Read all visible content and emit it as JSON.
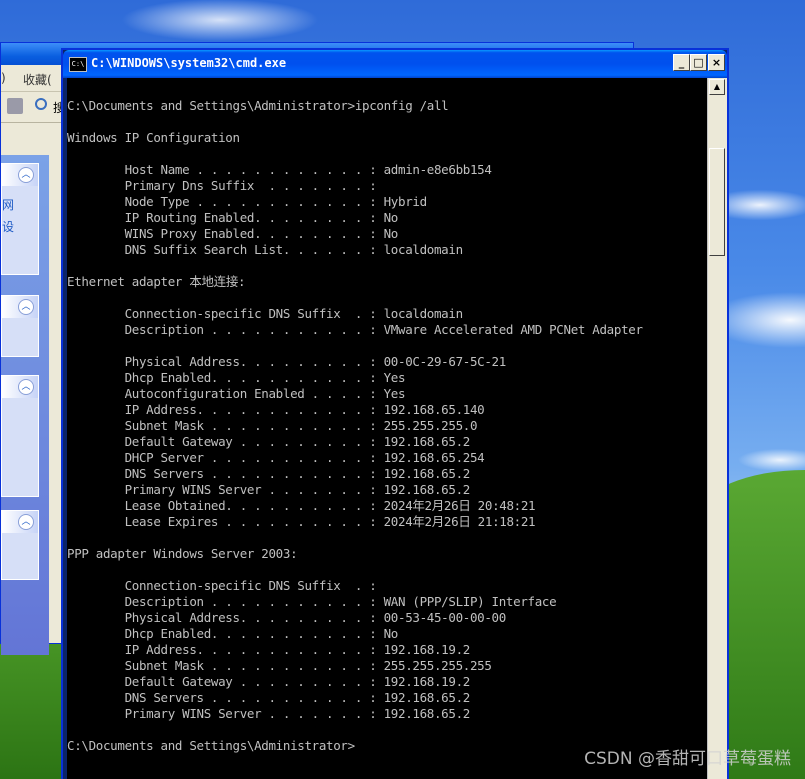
{
  "background_window": {
    "toolbar_left": ")",
    "toolbar_favorites": "收藏(",
    "toolbar_search_fragment": "搜",
    "task_fragments": [
      "网",
      "设"
    ]
  },
  "cmd": {
    "title": "C:\\WINDOWS\\system32\\cmd.exe",
    "minimize": "_",
    "maximize": "□",
    "close": "×",
    "lines": [
      "C:\\Documents and Settings\\Administrator>ipconfig /all",
      "",
      "Windows IP Configuration",
      "",
      "        Host Name . . . . . . . . . . . . : admin-e8e6bb154",
      "        Primary Dns Suffix  . . . . . . . :",
      "        Node Type . . . . . . . . . . . . : Hybrid",
      "        IP Routing Enabled. . . . . . . . : No",
      "        WINS Proxy Enabled. . . . . . . . : No",
      "        DNS Suffix Search List. . . . . . : localdomain",
      "",
      "Ethernet adapter 本地连接:",
      "",
      "        Connection-specific DNS Suffix  . : localdomain",
      "        Description . . . . . . . . . . . : VMware Accelerated AMD PCNet Adapter",
      "",
      "        Physical Address. . . . . . . . . : 00-0C-29-67-5C-21",
      "        Dhcp Enabled. . . . . . . . . . . : Yes",
      "        Autoconfiguration Enabled . . . . : Yes",
      "        IP Address. . . . . . . . . . . . : 192.168.65.140",
      "        Subnet Mask . . . . . . . . . . . : 255.255.255.0",
      "        Default Gateway . . . . . . . . . : 192.168.65.2",
      "        DHCP Server . . . . . . . . . . . : 192.168.65.254",
      "        DNS Servers . . . . . . . . . . . : 192.168.65.2",
      "        Primary WINS Server . . . . . . . : 192.168.65.2",
      "        Lease Obtained. . . . . . . . . . : 2024年2月26日 20:48:21",
      "        Lease Expires . . . . . . . . . . : 2024年2月26日 21:18:21",
      "",
      "PPP adapter Windows Server 2003:",
      "",
      "        Connection-specific DNS Suffix  . :",
      "        Description . . . . . . . . . . . : WAN (PPP/SLIP) Interface",
      "        Physical Address. . . . . . . . . : 00-53-45-00-00-00",
      "        Dhcp Enabled. . . . . . . . . . . : No",
      "        IP Address. . . . . . . . . . . . : 192.168.19.2",
      "        Subnet Mask . . . . . . . . . . . : 255.255.255.255",
      "        Default Gateway . . . . . . . . . : 192.168.19.2",
      "        DNS Servers . . . . . . . . . . . : 192.168.65.2",
      "        Primary WINS Server . . . . . . . : 192.168.65.2",
      "",
      "C:\\Documents and Settings\\Administrator>"
    ]
  },
  "watermark": "CSDN @香甜可口草莓蛋糕"
}
